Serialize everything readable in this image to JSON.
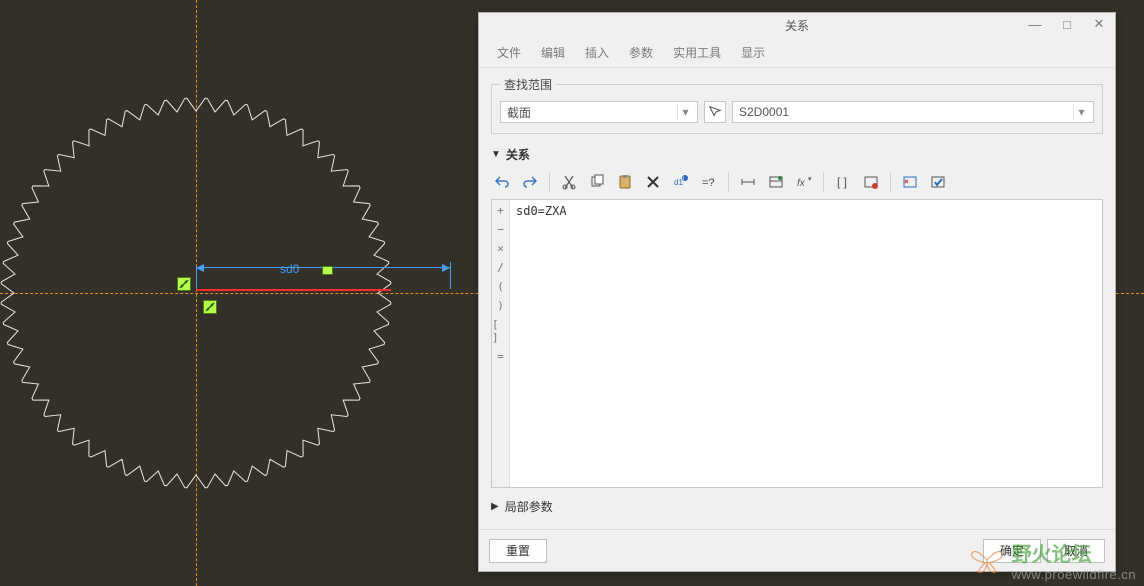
{
  "canvas": {
    "dim_label": "sd0"
  },
  "dialog": {
    "title": "关系",
    "menu": {
      "file": "文件",
      "edit": "编辑",
      "insert": "插入",
      "params": "参数",
      "tools": "实用工具",
      "display": "显示"
    },
    "search": {
      "legend": "查找范围",
      "left_value": "截面",
      "right_value": "S2D0001"
    },
    "section_label": "关系",
    "editor_text": "sd0=ZXA",
    "gutter": [
      "+",
      "−",
      "×",
      "/",
      "(",
      ")",
      "[ ]",
      "="
    ],
    "local_params_label": "局部参数",
    "buttons": {
      "reset": "重置",
      "ok": "确定",
      "cancel": "取消"
    }
  },
  "watermark": {
    "brand": "野火论坛",
    "url": "www.proewildfire.cn"
  }
}
